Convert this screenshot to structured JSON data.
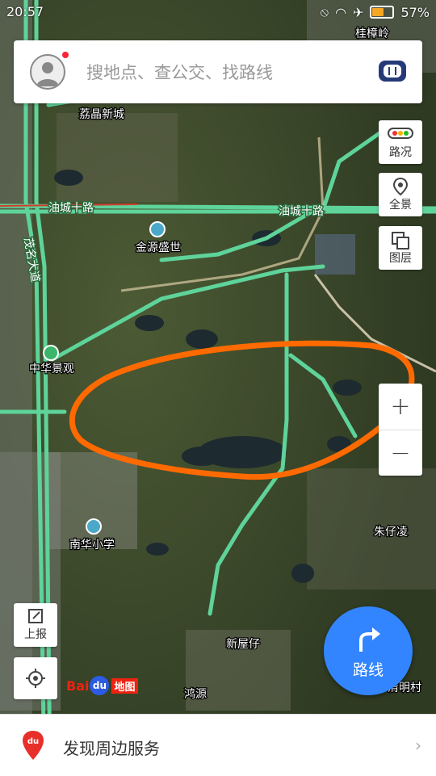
{
  "status_bar": {
    "time": "20:57",
    "battery": "57%"
  },
  "search": {
    "placeholder": "搜地点、查公交、找路线"
  },
  "right_controls": {
    "traffic": "路况",
    "panorama": "全景",
    "layers": "图层",
    "zoom_in": "+",
    "zoom_out": "−"
  },
  "left_controls": {
    "report": "上报"
  },
  "route_button": {
    "label": "路线"
  },
  "logo": {
    "bai": "Bai",
    "du": "du",
    "ditu": "地图"
  },
  "bottom_bar": {
    "label": "发现周边服务"
  },
  "map_labels": {
    "guizhangling": "桂樟岭",
    "libojing": "荔晶新城",
    "jinyuan": "金源盛世",
    "zhonghua": "中华景观",
    "nanhua": "南华小学",
    "zhuzailing": "朱仔凌",
    "xinwuzai": "新屋仔",
    "hongyuan": "鸿源",
    "qingming": "清明村",
    "maoming_road": "茂名大道",
    "roadA": "油城十路",
    "roadB": "油城十路"
  },
  "colors": {
    "accent": "#3385ff",
    "road": "#5ed39a",
    "annotation": "#ff6a00"
  }
}
